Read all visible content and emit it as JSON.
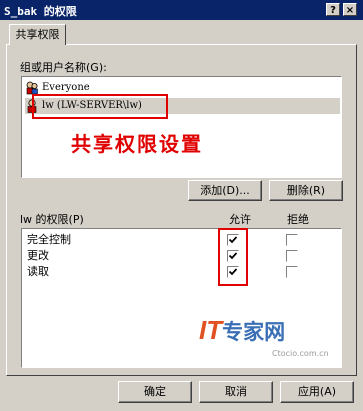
{
  "window": {
    "title": "S_bak 的权限",
    "help_glyph": "?",
    "close_glyph": "×"
  },
  "tabs": [
    {
      "label": "共享权限"
    }
  ],
  "users_group": {
    "label": "组或用户名称(G):",
    "items": [
      {
        "name": "Everyone",
        "icon": "user-group-icon",
        "selected": false
      },
      {
        "name": "lw (LW-SERVER\\lw)",
        "icon": "user-icon",
        "selected": true
      }
    ]
  },
  "annotation": {
    "text": "共享权限设置",
    "color": "#e00000"
  },
  "buttons": {
    "add": "添加(D)...",
    "remove": "删除(R)",
    "ok": "确定",
    "cancel": "取消",
    "apply": "应用(A)"
  },
  "permissions": {
    "label": "lw 的权限(P)",
    "allow_header": "允许",
    "deny_header": "拒绝",
    "rows": [
      {
        "name": "完全控制",
        "allow": true,
        "deny": false
      },
      {
        "name": "更改",
        "allow": true,
        "deny": false
      },
      {
        "name": "读取",
        "allow": true,
        "deny": false
      }
    ]
  },
  "watermark": {
    "brand_it": "IT",
    "brand_text": "专家网",
    "site": "Ctocio.com.cn"
  },
  "colors": {
    "titlebar": "#0a246a",
    "dialog": "#d4d0c8",
    "selection": "#d4d0c8",
    "highlight_annotation": "#e00000",
    "watermark_blue": "#3a6fb5"
  }
}
